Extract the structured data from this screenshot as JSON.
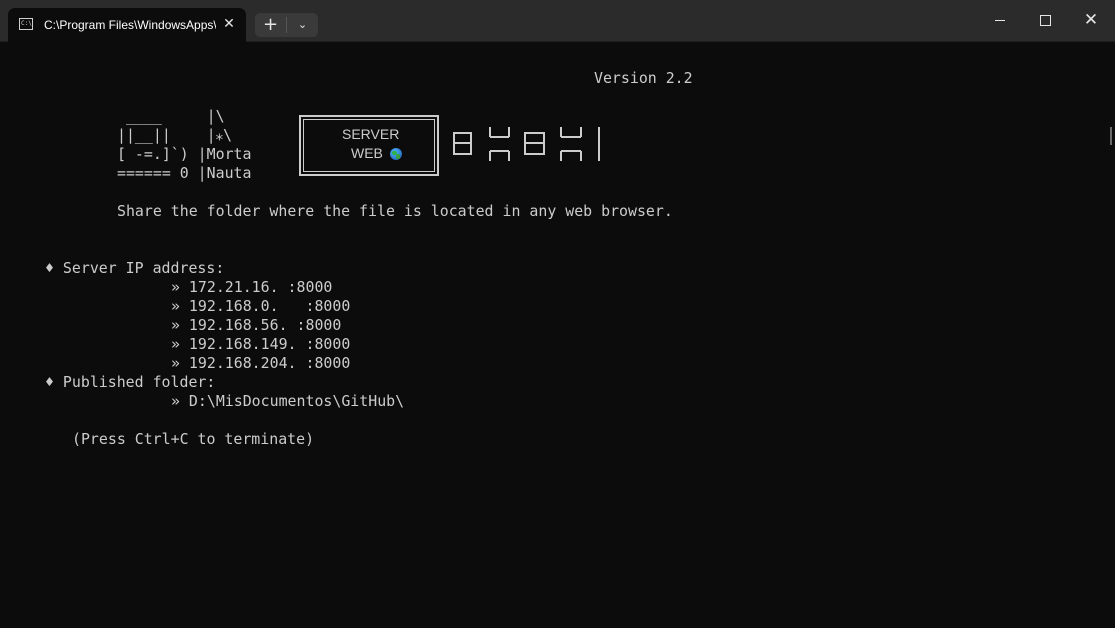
{
  "window": {
    "tab_title": "C:\\Program Files\\WindowsApps\\",
    "tab_icon_text": "C:\\",
    "close_tab": "✕",
    "new_tab": "+",
    "dropdown": "⌄",
    "close_window": "✕"
  },
  "console": {
    "version": "Version 2.2",
    "ascii_art": [
      " ____     |\\",
      "||__||    |⁎\\",
      "[ -=.]`) |Morta",
      "====== 0 |Nauta"
    ],
    "frame_server": "SERVER",
    "frame_web": "WEB",
    "description": "Share the folder where the file is located in any web browser.",
    "server_ip_label": "♦ Server IP address:",
    "ip_addresses": [
      "» 172.21.16. :8000",
      "» 192.168.0.   :8000",
      "» 192.168.56. :8000",
      "» 192.168.149. :8000",
      "» 192.168.204. :8000"
    ],
    "published_label": "♦ Published folder:",
    "published_path": "» D:\\MisDocumentos\\GitHub\\",
    "terminate_hint": "(Press Ctrl+C to terminate)"
  }
}
